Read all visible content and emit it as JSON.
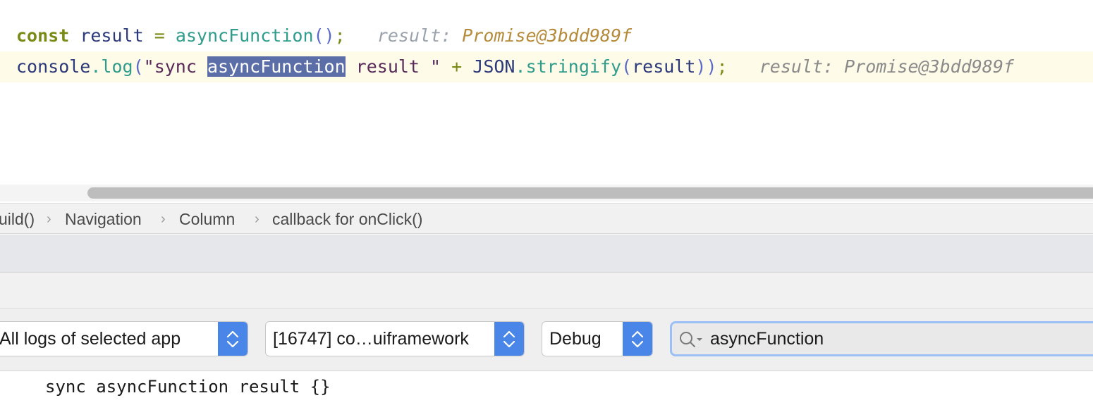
{
  "editor": {
    "line1": {
      "keyword": "const",
      "var": "result",
      "eq": "=",
      "fn": "asyncFunction",
      "parens": "()",
      "semi": ";",
      "hint_label": "result:",
      "hint_value": "Promise@3bdd989f"
    },
    "line2": {
      "obj": "console",
      "dot": ".",
      "method": "log",
      "open": "(",
      "str_start": "\"sync ",
      "highlight": "asyncFunction",
      "str_end": " result \"",
      "plus": "+",
      "json": "JSON",
      "dot2": ".",
      "stringify": "stringify",
      "open2": "(",
      "arg": "result",
      "close": "))",
      "semi": ";",
      "hint": "result: Promise@3bdd989f"
    }
  },
  "breadcrumb": {
    "items": [
      "uild()",
      "Navigation",
      "Column",
      "callback for onClick()"
    ]
  },
  "toolbar": {
    "log_scope": "All logs of selected app",
    "process": "[16747] co…uiframework",
    "level": "Debug",
    "search_value": "asyncFunction"
  },
  "console": {
    "output": "sync asyncFunction result {}"
  },
  "colors": {
    "accent": "#4a86e8",
    "highlight": "#5b6ea8",
    "current_line": "#fefbe8"
  },
  "icons": [
    "search-icon",
    "chevron-updown-icon"
  ]
}
